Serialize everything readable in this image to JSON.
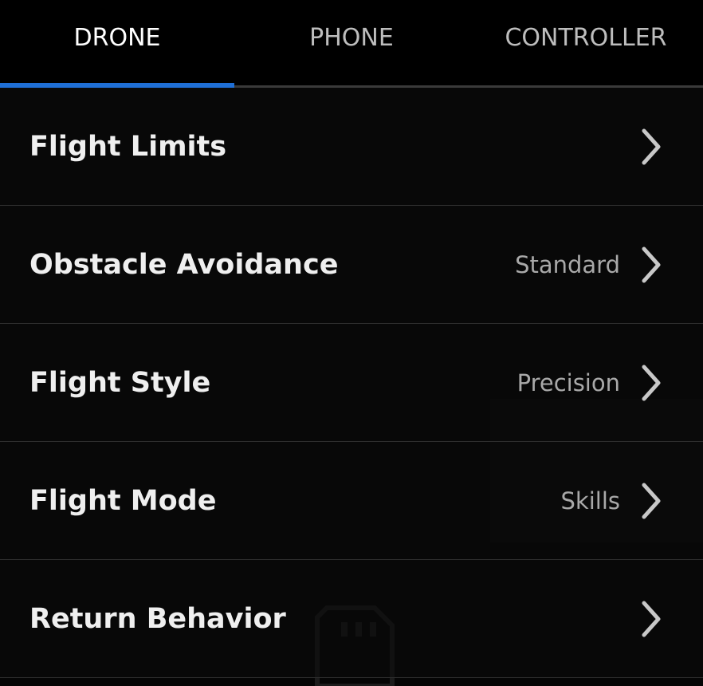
{
  "tabs": [
    {
      "label": "DRONE",
      "active": true
    },
    {
      "label": "PHONE",
      "active": false
    },
    {
      "label": "CONTROLLER",
      "active": false
    }
  ],
  "settings": [
    {
      "label": "Flight Limits",
      "value": ""
    },
    {
      "label": "Obstacle Avoidance",
      "value": "Standard"
    },
    {
      "label": "Flight Style",
      "value": "Precision"
    },
    {
      "label": "Flight Mode",
      "value": "Skills"
    },
    {
      "label": "Return Behavior",
      "value": ""
    }
  ],
  "icons": {
    "row_chevron": "chevron-right-icon",
    "background": "sd-card-question-icon"
  },
  "colors": {
    "accent": "#1f6fd6",
    "background": "#050505",
    "text": "#efefef",
    "value_text": "#a9a9a9"
  }
}
